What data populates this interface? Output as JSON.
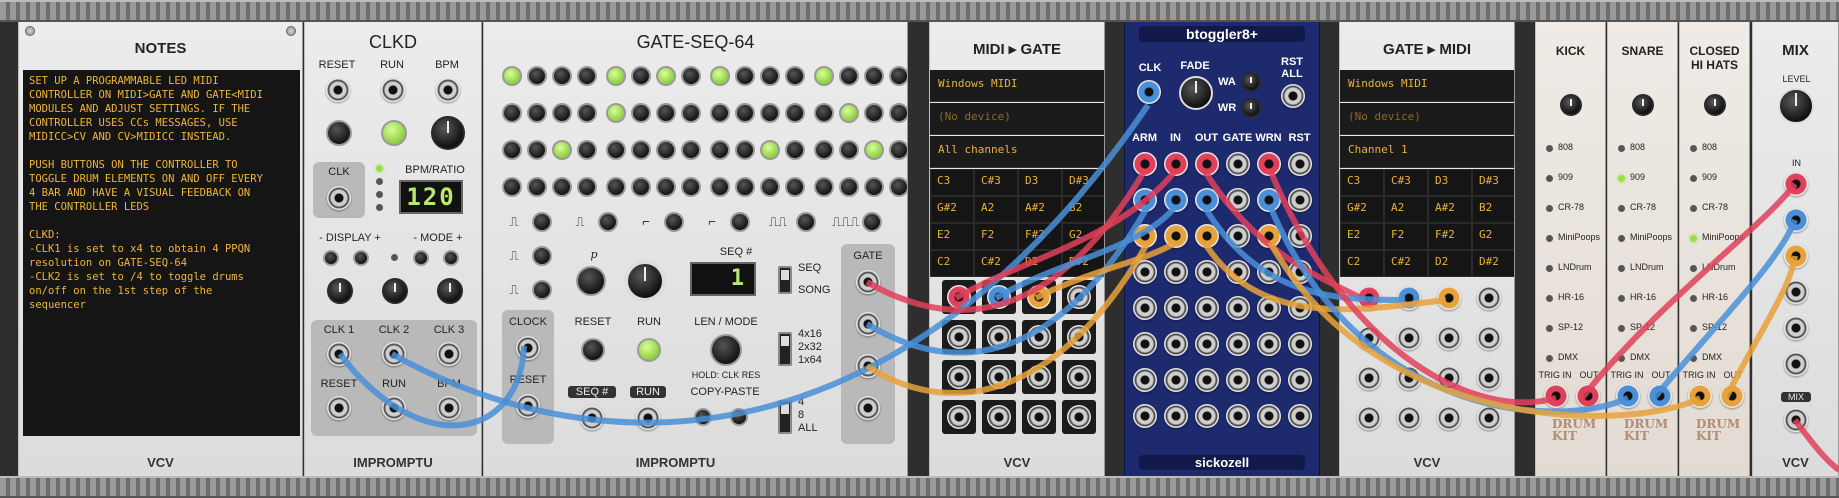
{
  "modules": {
    "notes": {
      "title": "NOTES",
      "text": "SET UP A PROGRAMMABLE LED MIDI\nCONTROLLER ON MIDI>GATE AND GATE<MIDI\nMODULES AND ADJUST SETTINGS. IF THE\nCONTROLLER USES CCs MESSAGES, USE\nMIDICC>CV AND CV>MIDICC INSTEAD.\n\nPUSH BUTTONS ON THE CONTROLLER TO\nTOGGLE DRUM ELEMENTS ON AND OFF EVERY\n4 BAR AND HAVE A VISUAL FEEDBACK ON\nTHE CONTROLLER LEDS\n\nCLKD:\n-CLK1 is set to x4 to obtain 4 PPQN\nresolution on GATE-SEQ-64\n-CLK2 is set to /4 to toggle drums\non/off on the 1st step of the\nsequencer",
      "brand": "VCV"
    },
    "clkd": {
      "title": "CLKD",
      "reset": "RESET",
      "run": "RUN",
      "bpm": "BPM",
      "clk": "CLK",
      "bpm_ratio": "BPM/RATIO",
      "display_value": "120",
      "display_label": "- DISPLAY +",
      "mode_label": "- MODE +",
      "clk1": "CLK 1",
      "clk2": "CLK 2",
      "clk3": "CLK 3",
      "reset_out": "RESET",
      "run_out": "RUN",
      "bpm_out": "BPM",
      "brand": "IMPROMPTU"
    },
    "gateseq": {
      "title": "GATE-SEQ-64",
      "p_label": "p",
      "seq_num_label": "SEQ #",
      "seq_display": "1",
      "seq": "SEQ",
      "song": "SONG",
      "clock": "CLOCK",
      "reset_btn": "RESET",
      "run_btn": "RUN",
      "len_mode": "LEN / MODE",
      "modes": "4x16\n2x32\n1x64",
      "hold": "HOLD: CLK RES",
      "reset_in": "RESET",
      "seq_in": "SEQ #",
      "run_in": "RUN",
      "copy_paste": "COPY-PASTE",
      "copy_opts": "4\n8\nALL",
      "gate": "GATE",
      "brand": "IMPROMPTU",
      "led_rows": [
        [
          1,
          0,
          0,
          0,
          1,
          0,
          1,
          0,
          1,
          0,
          0,
          0,
          1,
          0,
          0,
          0
        ],
        [
          0,
          0,
          0,
          0,
          1,
          0,
          0,
          0,
          0,
          0,
          0,
          0,
          0,
          1,
          0,
          0
        ],
        [
          0,
          0,
          1,
          0,
          0,
          0,
          0,
          0,
          0,
          0,
          1,
          0,
          0,
          0,
          1,
          0
        ],
        [
          0,
          0,
          0,
          0,
          0,
          0,
          0,
          0,
          0,
          0,
          0,
          0,
          0,
          0,
          0,
          0
        ]
      ]
    },
    "midigate": {
      "title": "MIDI ▸ GATE",
      "driver": "Windows MIDI",
      "device": "(No device)",
      "channel": "All channels",
      "notes": [
        "C3",
        "C#3",
        "D3",
        "D#3",
        "G#2",
        "A2",
        "A#2",
        "B2",
        "E2",
        "F2",
        "F#2",
        "G2",
        "C2",
        "C#2",
        "D2",
        "D#2"
      ],
      "brand": "VCV"
    },
    "btoggler": {
      "title": "btoggler8+",
      "clk": "CLK",
      "fade": "FADE",
      "rst_all": "RST\nALL",
      "wa": "WA",
      "wr": "WR",
      "headers": [
        "ARM",
        "IN",
        "OUT",
        "GATE",
        "WRN",
        "RST"
      ],
      "brand": "sickozell"
    },
    "gatemidi": {
      "title": "GATE ▸ MIDI",
      "driver": "Windows MIDI",
      "device": "(No device)",
      "channel": "Channel 1",
      "notes": [
        "C3",
        "C#3",
        "D3",
        "D#3",
        "G#2",
        "A2",
        "A#2",
        "B2",
        "E2",
        "F2",
        "F#2",
        "G2",
        "C2",
        "C#2",
        "D2",
        "D#2"
      ],
      "brand": "VCV"
    },
    "drums": [
      {
        "title": "KICK",
        "active": ""
      },
      {
        "title": "SNARE",
        "active": "909"
      },
      {
        "title": "CLOSED\nHI HATS",
        "active": "MiniPoops"
      }
    ],
    "drum_models": [
      "808",
      "909",
      "CR-78",
      "MiniPoops",
      "LNDrum",
      "HR-16",
      "SP-12",
      "DMX"
    ],
    "drum_io": {
      "trig_in": "TRIG IN",
      "out": "OUT",
      "logo": "DRUM\nKIT"
    },
    "mix": {
      "title": "MIX",
      "level": "LEVEL",
      "in": "IN",
      "mix": "MIX",
      "brand": "VCV"
    }
  },
  "colors": {
    "cable_red": "#e0405a",
    "cable_blue": "#4a8fd8",
    "cable_orange": "#e8a23a",
    "btoggler_bg": "#1d2a6e"
  }
}
